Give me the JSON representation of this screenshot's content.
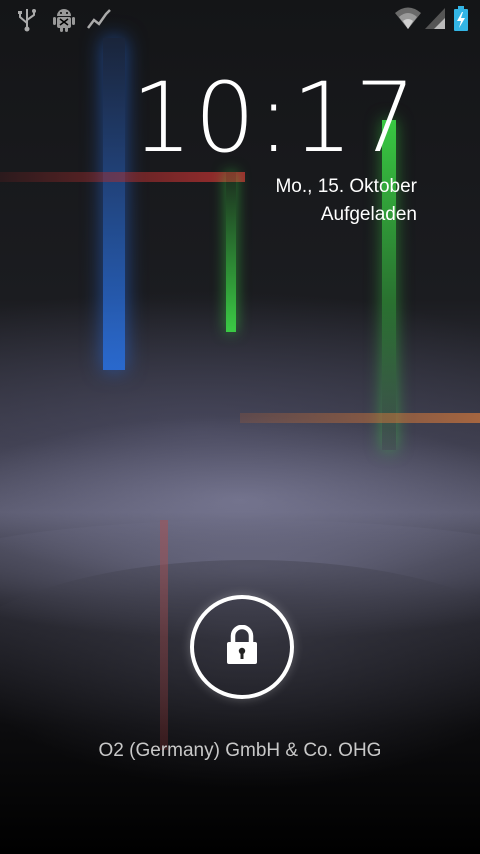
{
  "status_bar": {
    "left_icons": [
      "usb-icon",
      "android-debug-icon",
      "trend-icon"
    ],
    "right_icons": [
      "wifi-icon",
      "cell-signal-icon",
      "battery-charging-icon"
    ]
  },
  "lockscreen": {
    "time": "10:17",
    "date": "Mo., 15. Oktober",
    "status": "Aufgeladen",
    "carrier": "O2 (Germany) GmbH & Co. OHG"
  },
  "colors": {
    "battery": "#33b5e5",
    "streak_blue": "#2a6ed8",
    "streak_green": "#3cdc46",
    "streak_red": "#be3232",
    "streak_orange": "#d2783c"
  }
}
